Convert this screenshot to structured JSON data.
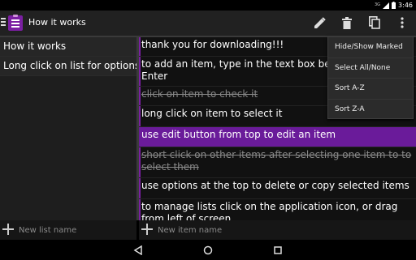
{
  "status_bar": {
    "network": "3G",
    "time": "3:46"
  },
  "toolbar": {
    "title": "How it works",
    "actions": [
      "edit-icon",
      "delete-icon",
      "copy-icon",
      "overflow-menu-icon"
    ]
  },
  "lists": [
    {
      "label": "How it works"
    },
    {
      "label": "Long click on list for options."
    }
  ],
  "items": [
    {
      "text": "thank you for downloading!!!",
      "done": false,
      "selected": false
    },
    {
      "text": "to add an item, type in the text box below and press Enter",
      "done": false,
      "selected": false
    },
    {
      "text": "click on item to check it",
      "done": true,
      "selected": false
    },
    {
      "text": "long click on item to select it",
      "done": false,
      "selected": false
    },
    {
      "text": "use edit button from top to edit an item",
      "done": false,
      "selected": true
    },
    {
      "text": "short click on other items after selecting one item to to select them",
      "done": true,
      "selected": false
    },
    {
      "text": "use options at the top to delete or copy selected items",
      "done": false,
      "selected": false
    },
    {
      "text": "to manage lists click on the application icon, or drag from left of screen",
      "done": false,
      "selected": false
    }
  ],
  "overflow_menu": {
    "items": [
      "Hide/Show Marked",
      "Select All/None",
      "Sort A-Z",
      "Sort Z-A"
    ]
  },
  "new_list": {
    "placeholder": "New list name",
    "value": ""
  },
  "new_item": {
    "placeholder": "New item name",
    "value": ""
  },
  "colors": {
    "accent": "#7b1fa2",
    "selected_row": "#6a1b9a",
    "toolbar": "#212121"
  }
}
